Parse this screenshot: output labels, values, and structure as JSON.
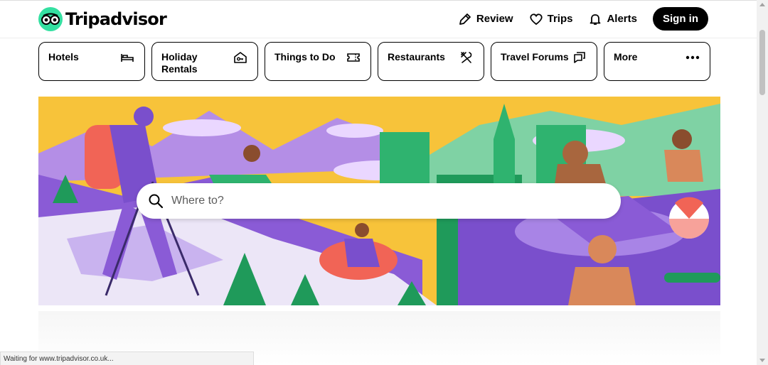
{
  "brand": {
    "name": "Tripadvisor",
    "logo_icon": "owl-eyes-icon",
    "color": "#34e0a1"
  },
  "nav": [
    {
      "label": "Review",
      "icon": "pencil-icon"
    },
    {
      "label": "Trips",
      "icon": "heart-icon"
    },
    {
      "label": "Alerts",
      "icon": "bell-icon"
    }
  ],
  "signin": {
    "label": "Sign in"
  },
  "categories": [
    {
      "label": "Hotels",
      "icon": "bed-icon"
    },
    {
      "label": "Holiday Rentals",
      "icon": "house-key-icon"
    },
    {
      "label": "Things to Do",
      "icon": "ticket-icon"
    },
    {
      "label": "Restaurants",
      "icon": "cutlery-icon"
    },
    {
      "label": "Travel Forums",
      "icon": "chat-bubbles-icon"
    },
    {
      "label": "More",
      "icon": "more-dots-icon"
    }
  ],
  "search": {
    "placeholder": "Where to?",
    "value": "",
    "icon": "search-icon"
  },
  "status_bar": {
    "text": "Waiting for www.tripadvisor.co.uk..."
  },
  "colors": {
    "hero_yellow": "#f7c33a",
    "hero_purple": "#8a5bd6",
    "hero_green": "#2fb36f",
    "text": "#000000"
  }
}
